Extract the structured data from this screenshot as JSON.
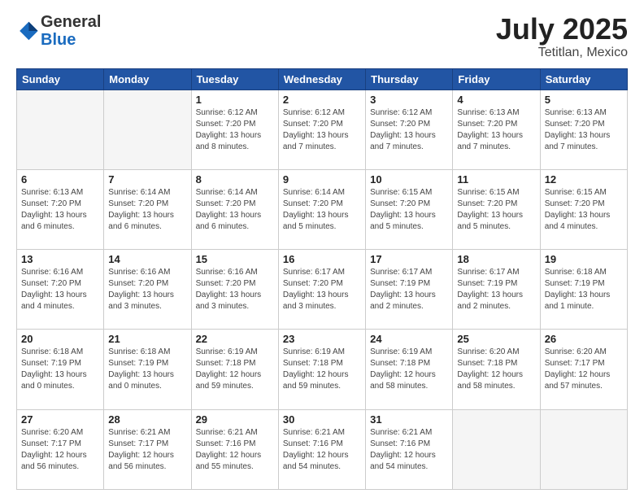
{
  "header": {
    "logo_line1": "General",
    "logo_line2": "Blue",
    "title": "July 2025",
    "subtitle": "Tetitlan, Mexico"
  },
  "calendar": {
    "days_of_week": [
      "Sunday",
      "Monday",
      "Tuesday",
      "Wednesday",
      "Thursday",
      "Friday",
      "Saturday"
    ],
    "weeks": [
      [
        {
          "num": "",
          "info": ""
        },
        {
          "num": "",
          "info": ""
        },
        {
          "num": "1",
          "info": "Sunrise: 6:12 AM\nSunset: 7:20 PM\nDaylight: 13 hours\nand 8 minutes."
        },
        {
          "num": "2",
          "info": "Sunrise: 6:12 AM\nSunset: 7:20 PM\nDaylight: 13 hours\nand 7 minutes."
        },
        {
          "num": "3",
          "info": "Sunrise: 6:12 AM\nSunset: 7:20 PM\nDaylight: 13 hours\nand 7 minutes."
        },
        {
          "num": "4",
          "info": "Sunrise: 6:13 AM\nSunset: 7:20 PM\nDaylight: 13 hours\nand 7 minutes."
        },
        {
          "num": "5",
          "info": "Sunrise: 6:13 AM\nSunset: 7:20 PM\nDaylight: 13 hours\nand 7 minutes."
        }
      ],
      [
        {
          "num": "6",
          "info": "Sunrise: 6:13 AM\nSunset: 7:20 PM\nDaylight: 13 hours\nand 6 minutes."
        },
        {
          "num": "7",
          "info": "Sunrise: 6:14 AM\nSunset: 7:20 PM\nDaylight: 13 hours\nand 6 minutes."
        },
        {
          "num": "8",
          "info": "Sunrise: 6:14 AM\nSunset: 7:20 PM\nDaylight: 13 hours\nand 6 minutes."
        },
        {
          "num": "9",
          "info": "Sunrise: 6:14 AM\nSunset: 7:20 PM\nDaylight: 13 hours\nand 5 minutes."
        },
        {
          "num": "10",
          "info": "Sunrise: 6:15 AM\nSunset: 7:20 PM\nDaylight: 13 hours\nand 5 minutes."
        },
        {
          "num": "11",
          "info": "Sunrise: 6:15 AM\nSunset: 7:20 PM\nDaylight: 13 hours\nand 5 minutes."
        },
        {
          "num": "12",
          "info": "Sunrise: 6:15 AM\nSunset: 7:20 PM\nDaylight: 13 hours\nand 4 minutes."
        }
      ],
      [
        {
          "num": "13",
          "info": "Sunrise: 6:16 AM\nSunset: 7:20 PM\nDaylight: 13 hours\nand 4 minutes."
        },
        {
          "num": "14",
          "info": "Sunrise: 6:16 AM\nSunset: 7:20 PM\nDaylight: 13 hours\nand 3 minutes."
        },
        {
          "num": "15",
          "info": "Sunrise: 6:16 AM\nSunset: 7:20 PM\nDaylight: 13 hours\nand 3 minutes."
        },
        {
          "num": "16",
          "info": "Sunrise: 6:17 AM\nSunset: 7:20 PM\nDaylight: 13 hours\nand 3 minutes."
        },
        {
          "num": "17",
          "info": "Sunrise: 6:17 AM\nSunset: 7:19 PM\nDaylight: 13 hours\nand 2 minutes."
        },
        {
          "num": "18",
          "info": "Sunrise: 6:17 AM\nSunset: 7:19 PM\nDaylight: 13 hours\nand 2 minutes."
        },
        {
          "num": "19",
          "info": "Sunrise: 6:18 AM\nSunset: 7:19 PM\nDaylight: 13 hours\nand 1 minute."
        }
      ],
      [
        {
          "num": "20",
          "info": "Sunrise: 6:18 AM\nSunset: 7:19 PM\nDaylight: 13 hours\nand 0 minutes."
        },
        {
          "num": "21",
          "info": "Sunrise: 6:18 AM\nSunset: 7:19 PM\nDaylight: 13 hours\nand 0 minutes."
        },
        {
          "num": "22",
          "info": "Sunrise: 6:19 AM\nSunset: 7:18 PM\nDaylight: 12 hours\nand 59 minutes."
        },
        {
          "num": "23",
          "info": "Sunrise: 6:19 AM\nSunset: 7:18 PM\nDaylight: 12 hours\nand 59 minutes."
        },
        {
          "num": "24",
          "info": "Sunrise: 6:19 AM\nSunset: 7:18 PM\nDaylight: 12 hours\nand 58 minutes."
        },
        {
          "num": "25",
          "info": "Sunrise: 6:20 AM\nSunset: 7:18 PM\nDaylight: 12 hours\nand 58 minutes."
        },
        {
          "num": "26",
          "info": "Sunrise: 6:20 AM\nSunset: 7:17 PM\nDaylight: 12 hours\nand 57 minutes."
        }
      ],
      [
        {
          "num": "27",
          "info": "Sunrise: 6:20 AM\nSunset: 7:17 PM\nDaylight: 12 hours\nand 56 minutes."
        },
        {
          "num": "28",
          "info": "Sunrise: 6:21 AM\nSunset: 7:17 PM\nDaylight: 12 hours\nand 56 minutes."
        },
        {
          "num": "29",
          "info": "Sunrise: 6:21 AM\nSunset: 7:16 PM\nDaylight: 12 hours\nand 55 minutes."
        },
        {
          "num": "30",
          "info": "Sunrise: 6:21 AM\nSunset: 7:16 PM\nDaylight: 12 hours\nand 54 minutes."
        },
        {
          "num": "31",
          "info": "Sunrise: 6:21 AM\nSunset: 7:16 PM\nDaylight: 12 hours\nand 54 minutes."
        },
        {
          "num": "",
          "info": ""
        },
        {
          "num": "",
          "info": ""
        }
      ]
    ]
  }
}
